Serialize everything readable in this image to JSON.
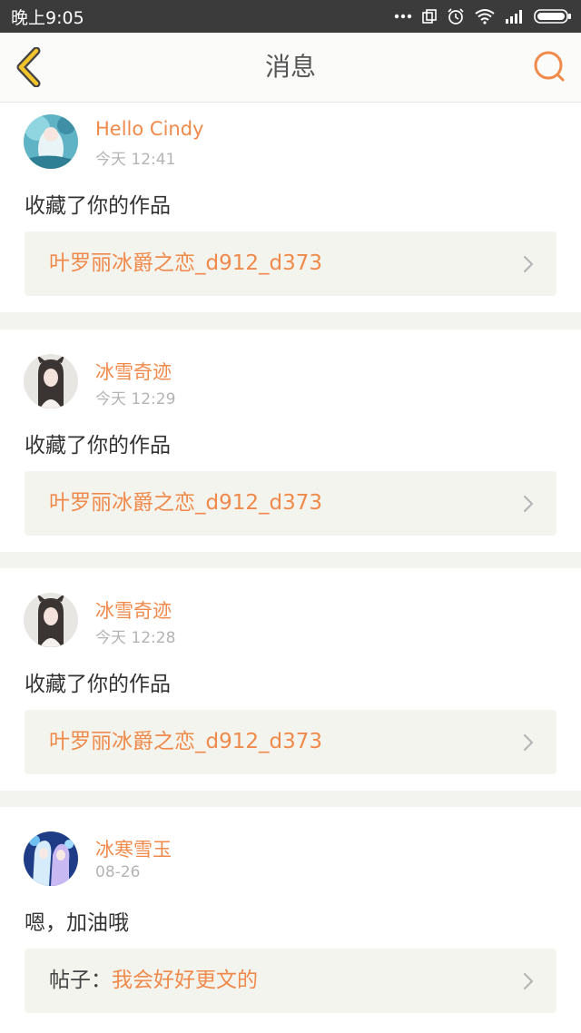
{
  "status_bar": {
    "time": "晚上9:05",
    "icons": [
      "more-dots-icon",
      "screen-rotation-icon",
      "alarm-clock-icon",
      "wifi-icon",
      "signal-bars-icon",
      "battery-icon"
    ]
  },
  "header": {
    "title": "消息",
    "back_icon": "chevron-left-icon",
    "search_icon": "search-icon"
  },
  "colors": {
    "accent": "#f08a4b",
    "back_arrow": "#f4c52b",
    "status_bar": "#3b3b3b"
  },
  "messages": [
    {
      "username": "Hello Cindy",
      "time": "今天 12:41",
      "text": "收藏了你的作品",
      "link_prefix": "",
      "link": "叶罗丽冰爵之恋_d912_d373"
    },
    {
      "username": "冰雪奇迹",
      "time": "今天 12:29",
      "text": "收藏了你的作品",
      "link_prefix": "",
      "link": "叶罗丽冰爵之恋_d912_d373"
    },
    {
      "username": "冰雪奇迹",
      "time": "今天 12:28",
      "text": "收藏了你的作品",
      "link_prefix": "",
      "link": "叶罗丽冰爵之恋_d912_d373"
    },
    {
      "username": "冰寒雪玉",
      "time": "08-26",
      "text": "嗯，加油哦",
      "link_prefix": "帖子：",
      "link": "我会好好更文的"
    }
  ]
}
